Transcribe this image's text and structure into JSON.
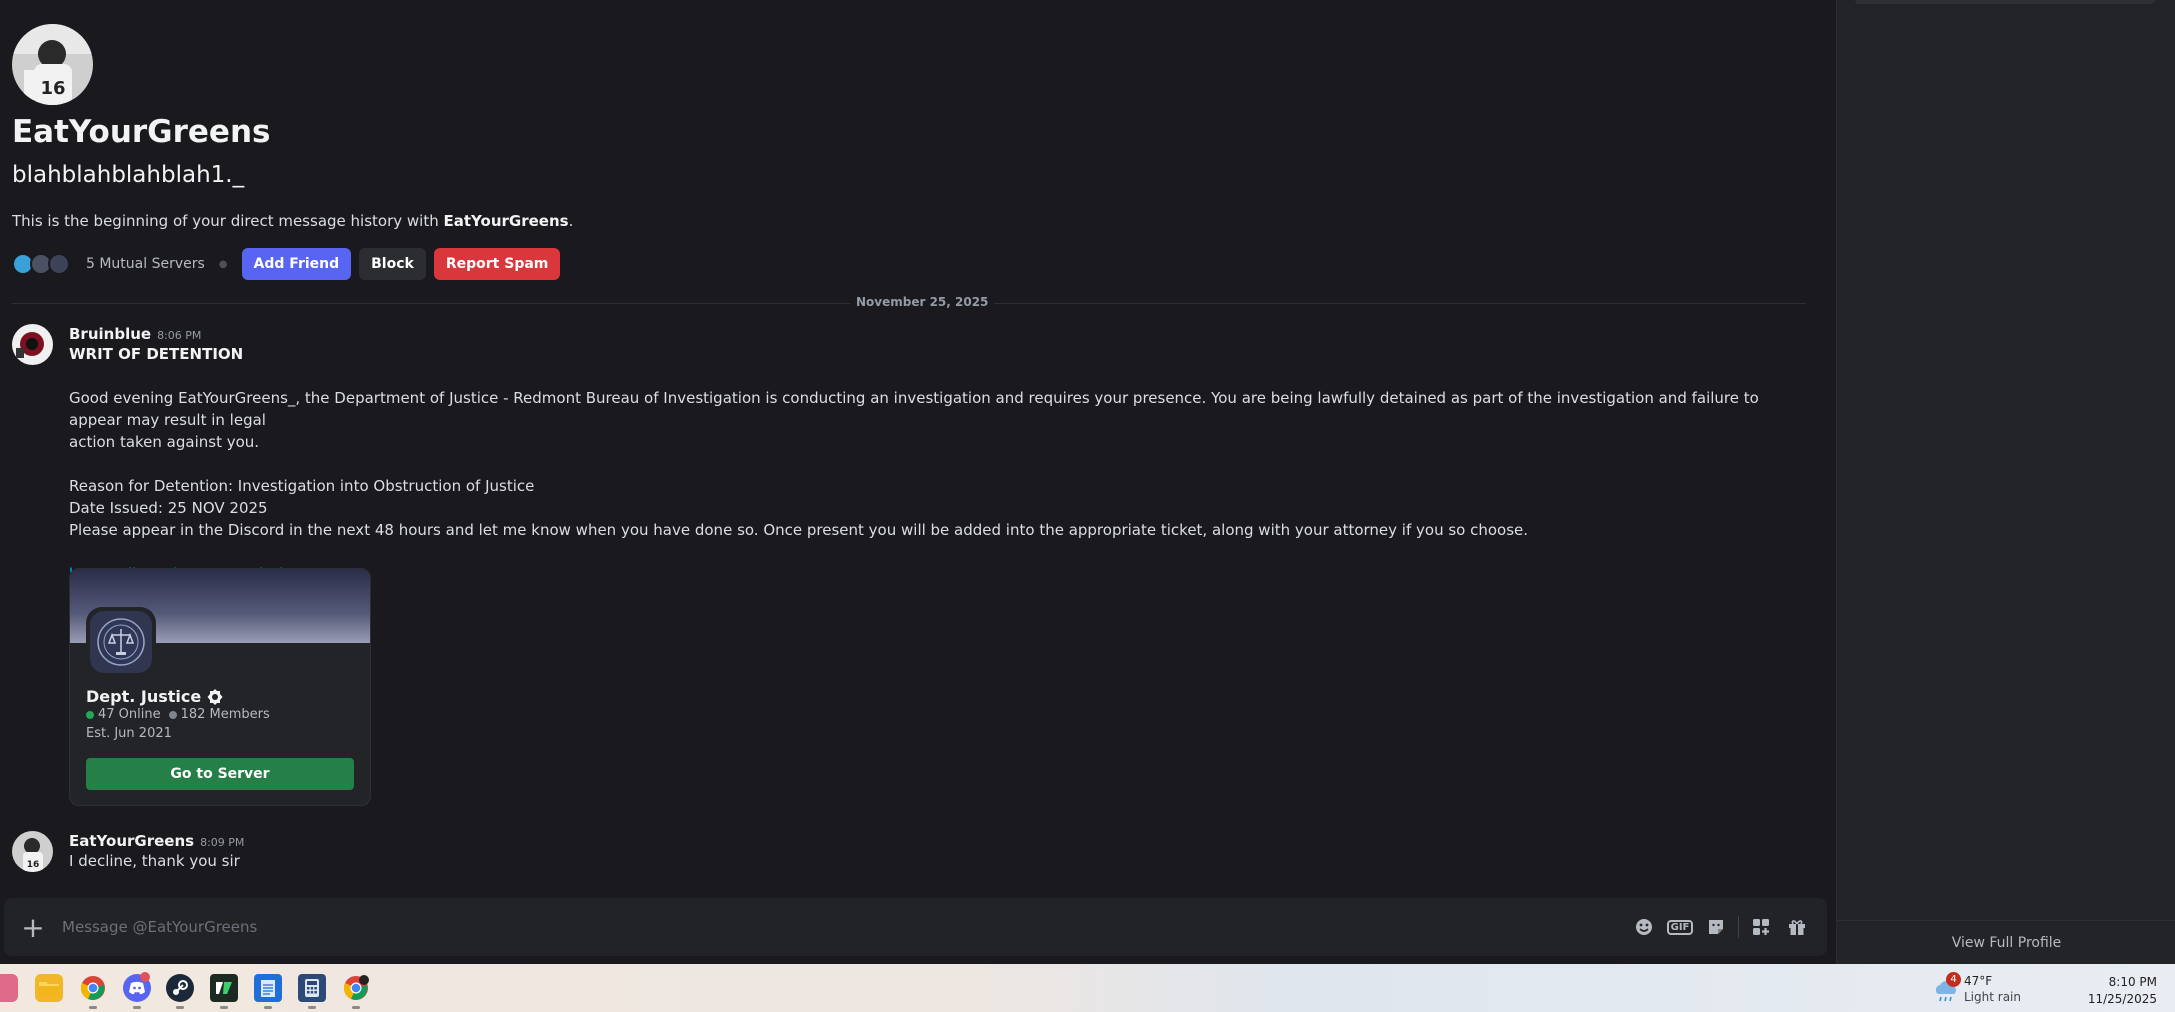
{
  "profile": {
    "display_name": "EatYourGreens",
    "username": "blahblahblahblah1._",
    "intro_prefix": "This is the beginning of your direct message history with ",
    "intro_name": "EatYourGreens",
    "intro_suffix": ".",
    "mutual_servers": "5 Mutual Servers",
    "add_friend": "Add Friend",
    "block": "Block",
    "report_spam": "Report Spam"
  },
  "date_divider": "November 25, 2025",
  "messages": [
    {
      "author": "Bruinblue",
      "time": "8:06 PM",
      "lines": [
        "WRIT OF DETENTION",
        "Good evening EatYourGreens_, the Department of Justice - Redmont Bureau of Investigation is conducting an investigation and requires your presence. You are being lawfully detained as part of the investigation and failure to appear may result in legal",
        "action taken against you.",
        "Reason for Detention: Investigation into Obstruction of Justice",
        "Date Issued: 25 NOV 2025",
        "Please appear in the Discord in the next 48 hours and let me know when you have done so. Once present you will be added into the appropriate ticket, along with your attorney if you so choose."
      ],
      "link": "https://discord.gg/B7UHNhZh6H"
    },
    {
      "author": "EatYourGreens",
      "time": "8:09 PM",
      "lines": [
        "I decline, thank you sir"
      ]
    }
  ],
  "invite": {
    "server_name": "Dept. Justice",
    "online": "47 Online",
    "members": "182 Members",
    "established": "Est. Jun 2021",
    "button": "Go to Server"
  },
  "composer": {
    "placeholder": "Message @EatYourGreens",
    "gif_label": "GIF"
  },
  "side_panel": {
    "view_full_profile": "View Full Profile"
  },
  "taskbar": {
    "weather_badge": "4",
    "temperature": "47°F",
    "condition": "Light rain",
    "time": "8:10 PM",
    "date": "11/25/2025"
  },
  "colors": {
    "blurple": "#5865f2",
    "danger": "#da373c",
    "success": "#248046",
    "link": "#00a8fc"
  }
}
